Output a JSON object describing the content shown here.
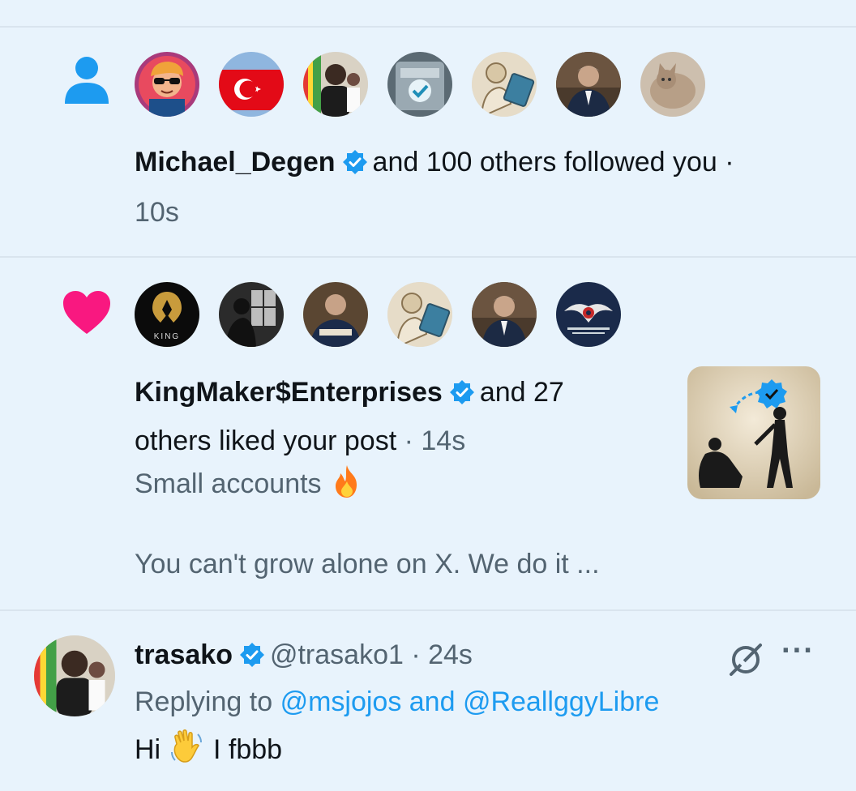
{
  "follow_notification": {
    "avatars": [
      {
        "name": "avatar-sunglasses-man"
      },
      {
        "name": "avatar-turkey-flag"
      },
      {
        "name": "avatar-colorful-portrait"
      },
      {
        "name": "avatar-machine-logo"
      },
      {
        "name": "avatar-sketch-figure"
      },
      {
        "name": "avatar-suited-man"
      },
      {
        "name": "avatar-cat"
      }
    ],
    "username": "Michael_Degen",
    "action": "and 100 others followed you ·",
    "time": "10s"
  },
  "like_notification": {
    "avatars": [
      {
        "name": "avatar-king-logo",
        "label": "KING"
      },
      {
        "name": "avatar-window-silhouette"
      },
      {
        "name": "avatar-suited-man-2"
      },
      {
        "name": "avatar-sketch-figure-2"
      },
      {
        "name": "avatar-suited-man-3"
      },
      {
        "name": "avatar-eagle-emblem"
      }
    ],
    "username": "KingMaker$Enterprises",
    "action_line1": "and 27",
    "action_line2": "others liked your post",
    "time": "· 14s",
    "post_line1": "Small accounts",
    "post_line2": "You can't grow alone on X. We do it ..."
  },
  "reply": {
    "username": "trasako",
    "handle": "@trasako1 · 24s",
    "replying_prefix": "Replying to",
    "replying_targets": "@msjojos and @ReallggyLibre",
    "message_start": "Hi",
    "message_end": "I fbbb",
    "more_label": "···"
  },
  "colors": {
    "background": "#e8f3fc",
    "accent": "#1d9bf0",
    "like": "#f91880",
    "text_secondary": "#536471"
  }
}
